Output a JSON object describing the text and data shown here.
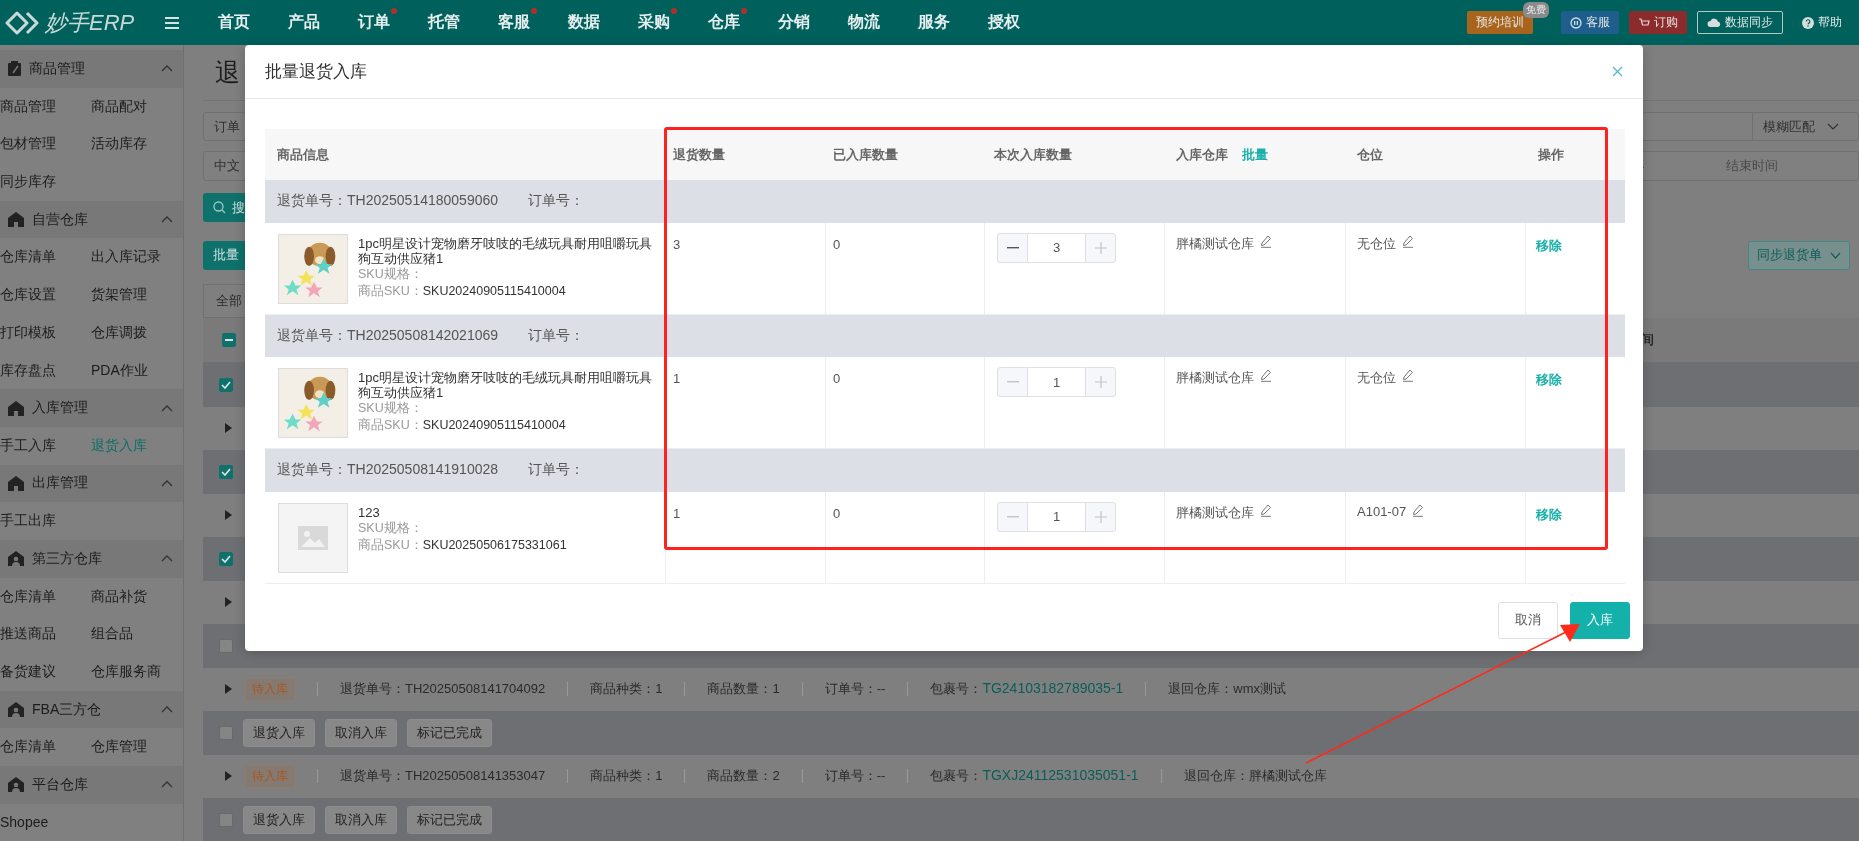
{
  "topbar": {
    "logo_text": "妙手ERP",
    "nav": [
      {
        "label": "首页",
        "notice": false
      },
      {
        "label": "产品",
        "notice": false
      },
      {
        "label": "订单",
        "notice": true
      },
      {
        "label": "托管",
        "notice": false
      },
      {
        "label": "客服",
        "notice": true
      },
      {
        "label": "数据",
        "notice": false
      },
      {
        "label": "采购",
        "notice": true
      },
      {
        "label": "仓库",
        "notice": true
      },
      {
        "label": "分销",
        "notice": false
      },
      {
        "label": "物流",
        "notice": false
      },
      {
        "label": "服务",
        "notice": false
      },
      {
        "label": "授权",
        "notice": false
      }
    ],
    "actions": [
      {
        "label": "预约培训",
        "kind": "training",
        "badge": "免费"
      },
      {
        "label": "客服",
        "kind": "service"
      },
      {
        "label": "订购",
        "kind": "order"
      },
      {
        "label": "数据同步",
        "kind": "sync"
      },
      {
        "label": "帮助",
        "kind": "help"
      }
    ]
  },
  "sidebar": [
    {
      "title": "商品管理",
      "kind": "clipboard",
      "expanded": true,
      "items": [
        {
          "label": "商品管理",
          "selected": false
        },
        {
          "label": "商品配对",
          "selected": false
        },
        {
          "label": "包材管理",
          "selected": false
        },
        {
          "label": "活动库存",
          "selected": false
        },
        {
          "label": "同步库存",
          "selected": false
        }
      ]
    },
    {
      "title": "自营仓库",
      "kind": "house",
      "expanded": true,
      "items": [
        {
          "label": "仓库清单",
          "selected": false
        },
        {
          "label": "出入库记录",
          "selected": false
        },
        {
          "label": "仓库设置",
          "selected": false
        },
        {
          "label": "货架管理",
          "selected": false
        },
        {
          "label": "打印模板",
          "selected": false
        },
        {
          "label": "仓库调拨",
          "selected": false
        },
        {
          "label": "库存盘点",
          "selected": false
        },
        {
          "label": "PDA作业",
          "selected": false
        }
      ]
    },
    {
      "title": "入库管理",
      "kind": "house",
      "expanded": true,
      "items": [
        {
          "label": "手工入库",
          "selected": false
        },
        {
          "label": "退货入库",
          "selected": true
        }
      ]
    },
    {
      "title": "出库管理",
      "kind": "house",
      "expanded": true,
      "items": [
        {
          "label": "手工出库",
          "selected": false
        }
      ]
    },
    {
      "title": "第三方仓库",
      "kind": "person",
      "expanded": true,
      "items": [
        {
          "label": "仓库清单",
          "selected": false
        },
        {
          "label": "商品补货",
          "selected": false
        },
        {
          "label": "推送商品",
          "selected": false
        },
        {
          "label": "组合品",
          "selected": false
        },
        {
          "label": "备货建议",
          "selected": false
        },
        {
          "label": "仓库服务商",
          "selected": false
        }
      ]
    },
    {
      "title": "FBA三方仓",
      "kind": "person",
      "expanded": true,
      "items": [
        {
          "label": "仓库清单",
          "selected": false
        },
        {
          "label": "仓库管理",
          "selected": false
        }
      ]
    },
    {
      "title": "平台仓库",
      "kind": "person",
      "expanded": true,
      "items": [
        {
          "label": "Shopee",
          "selected": false
        }
      ]
    }
  ],
  "page": {
    "title": "退",
    "order_field": "订单",
    "match_select": "模糊匹配",
    "lang_field": "中文",
    "range_separator": "-",
    "end_time_placeholder": "结束时间",
    "search_button": "搜",
    "batch_button": "批量",
    "sync_button": "同步退货单",
    "tab": "全部",
    "select_all_indeterminate": true,
    "header_tail": "间",
    "rows": [
      {
        "kind": "actions",
        "checked": true
      },
      {
        "kind": "summary"
      },
      {
        "kind": "actions",
        "checked": true
      },
      {
        "kind": "summary"
      },
      {
        "kind": "actions",
        "checked": true
      },
      {
        "kind": "summary"
      },
      {
        "kind": "actions",
        "checked": false
      },
      {
        "kind": "summary",
        "status": "待入库",
        "fields": [
          {
            "kind": "text",
            "text": "退货单号：TH20250508141704092"
          },
          {
            "kind": "text",
            "text": "商品种类：1"
          },
          {
            "kind": "text",
            "text": "商品数量：1"
          },
          {
            "kind": "text",
            "text": "订单号：--"
          },
          {
            "kind": "link",
            "label": "包裹号：",
            "link": "TG24103182789035-1"
          },
          {
            "kind": "text",
            "text": "退回仓库：wmx测试"
          }
        ]
      },
      {
        "kind": "actions",
        "checked": false,
        "buttons": [
          "退货入库",
          "取消入库",
          "标记已完成"
        ]
      },
      {
        "kind": "summary",
        "status": "待入库",
        "fields": [
          {
            "kind": "text",
            "text": "退货单号：TH20250508141353047"
          },
          {
            "kind": "text",
            "text": "商品种类：1"
          },
          {
            "kind": "text",
            "text": "商品数量：2"
          },
          {
            "kind": "text",
            "text": "订单号：--"
          },
          {
            "kind": "link",
            "label": "包裹号：",
            "link": "TGXJ24112531035051-1"
          },
          {
            "kind": "text",
            "text": "退回仓库：胖橘测试仓库"
          }
        ]
      },
      {
        "kind": "actions",
        "checked": false,
        "buttons": [
          "退货入库",
          "取消入库",
          "标记已完成"
        ]
      }
    ]
  },
  "dialog": {
    "title": "批量退货入库",
    "columns": [
      {
        "label": "商品信息"
      },
      {
        "label": "退货数量"
      },
      {
        "label": "已入库数量"
      },
      {
        "label": "本次入库数量"
      },
      {
        "label": "入库仓库",
        "action": "批量"
      },
      {
        "label": "仓位"
      },
      {
        "label": "操作"
      }
    ],
    "groups": [
      {
        "return_no": "退货单号：TH20250514180059060",
        "order_no": "订单号：",
        "name": "1pc明星设计宠物磨牙吱吱的毛绒玩具耐用咀嚼玩具狗互动供应猪1",
        "spec_label": "SKU规格：",
        "sku_label": "商品SKU：",
        "sku": "SKU20240905115410004",
        "return_qty": "3",
        "received_qty": "0",
        "qty": "3",
        "minus_disabled": false,
        "plus_disabled": true,
        "warehouse": "胖橘测试仓库",
        "location": "无仓位",
        "action": "移除"
      },
      {
        "return_no": "退货单号：TH20250508142021069",
        "order_no": "订单号：",
        "name": "1pc明星设计宠物磨牙吱吱的毛绒玩具耐用咀嚼玩具狗互动供应猪1",
        "spec_label": "SKU规格：",
        "sku_label": "商品SKU：",
        "sku": "SKU20240905115410004",
        "return_qty": "1",
        "received_qty": "0",
        "qty": "1",
        "minus_disabled": true,
        "plus_disabled": true,
        "warehouse": "胖橘测试仓库",
        "location": "无仓位",
        "action": "移除"
      },
      {
        "return_no": "退货单号：TH20250508141910028",
        "order_no": "订单号：",
        "thumbnail": {
          "kind": "placeholder"
        },
        "name": "123",
        "spec_label": "SKU规格：",
        "sku_label": "商品SKU：",
        "sku": "SKU20250506175331061",
        "return_qty": "1",
        "received_qty": "0",
        "qty": "1",
        "minus_disabled": true,
        "plus_disabled": true,
        "warehouse": "胖橘测试仓库",
        "location": "A101-07",
        "action": "移除"
      }
    ],
    "buttons": [
      {
        "label": "取消",
        "kind": "default"
      },
      {
        "label": "入库",
        "kind": "primary"
      }
    ]
  }
}
